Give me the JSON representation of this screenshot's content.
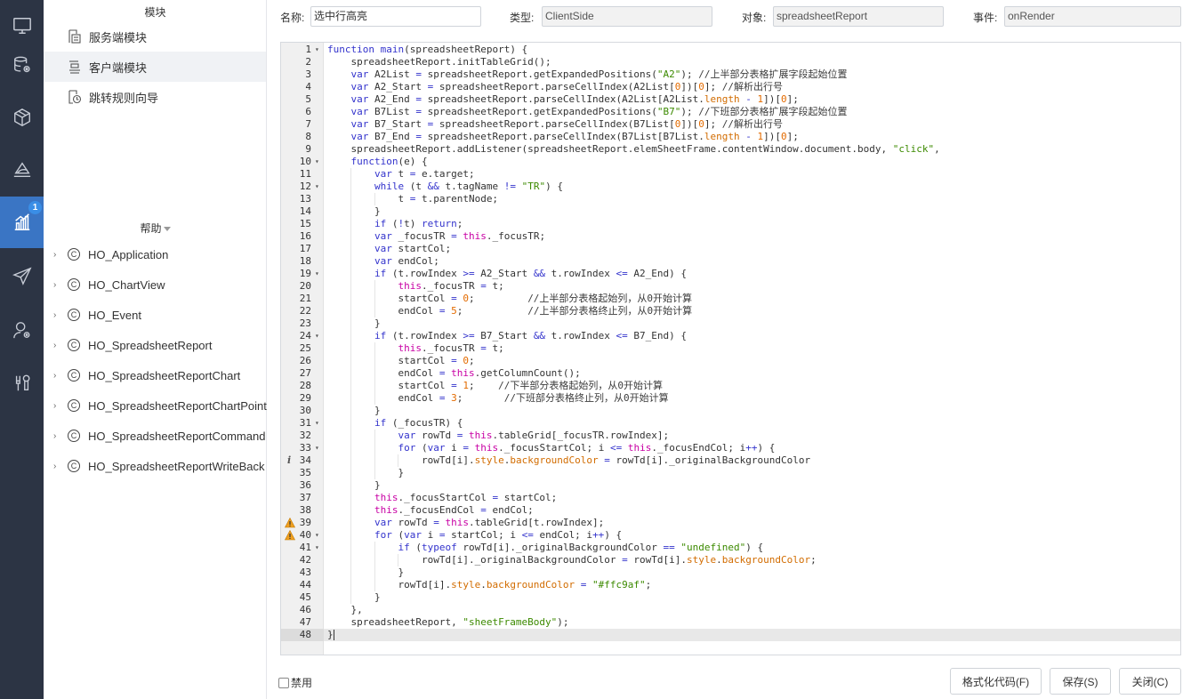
{
  "rail": {
    "items": [
      {
        "icon": "monitor-icon"
      },
      {
        "icon": "database-gear-icon"
      },
      {
        "icon": "cube-icon"
      },
      {
        "icon": "layers-icon"
      },
      {
        "icon": "chart-bar-icon",
        "badge": "1",
        "active": true
      },
      {
        "icon": "send-icon"
      },
      {
        "icon": "user-settings-icon"
      },
      {
        "icon": "tools-icon"
      }
    ]
  },
  "modules": {
    "title": "模块",
    "items": [
      {
        "label": "服务端模块",
        "icon": "server-module-icon"
      },
      {
        "label": "客户端模块",
        "icon": "client-module-icon",
        "selected": true
      },
      {
        "label": "跳转规则向导",
        "icon": "redirect-wizard-icon"
      }
    ]
  },
  "help": {
    "title": "帮助",
    "items": [
      "HO_Application",
      "HO_ChartView",
      "HO_Event",
      "HO_SpreadsheetReport",
      "HO_SpreadsheetReportChart",
      "HO_SpreadsheetReportChartPoint",
      "HO_SpreadsheetReportCommand",
      "HO_SpreadsheetReportWriteBack"
    ]
  },
  "form": {
    "name_label": "名称:",
    "name_value": "选中行高亮",
    "type_label": "类型:",
    "type_value": "ClientSide",
    "object_label": "对象:",
    "object_value": "spreadsheetReport",
    "event_label": "事件:",
    "event_value": "onRender"
  },
  "editor": {
    "current_line": 48,
    "lines": [
      "function main(spreadsheetReport) {",
      "    spreadsheetReport.initTableGrid();",
      "    var A2List = spreadsheetReport.getExpandedPositions(\"A2\"); //上半部分表格扩展字段起始位置",
      "    var A2_Start = spreadsheetReport.parseCellIndex(A2List[0])[0]; //解析出行号",
      "    var A2_End = spreadsheetReport.parseCellIndex(A2List[A2List.length - 1])[0];",
      "    var B7List = spreadsheetReport.getExpandedPositions(\"B7\"); //下班部分表格扩展字段起始位置",
      "    var B7_Start = spreadsheetReport.parseCellIndex(B7List[0])[0]; //解析出行号",
      "    var B7_End = spreadsheetReport.parseCellIndex(B7List[B7List.length - 1])[0];",
      "    spreadsheetReport.addListener(spreadsheetReport.elemSheetFrame.contentWindow.document.body, \"click\",",
      "    function(e) {",
      "        var t = e.target;",
      "        while (t && t.tagName != \"TR\") {",
      "            t = t.parentNode;",
      "        }",
      "        if (!t) return;",
      "        var _focusTR = this._focusTR;",
      "        var startCol;",
      "        var endCol;",
      "        if (t.rowIndex >= A2_Start && t.rowIndex <= A2_End) {",
      "            this._focusTR = t;",
      "            startCol = 0;         //上半部分表格起始列，从0开始计算",
      "            endCol = 5;           //上半部分表格终止列，从0开始计算",
      "        }",
      "        if (t.rowIndex >= B7_Start && t.rowIndex <= B7_End) {",
      "            this._focusTR = t;",
      "            startCol = 0;",
      "            endCol = this.getColumnCount();",
      "            startCol = 1;    //下半部分表格起始列，从0开始计算",
      "            endCol = 3;       //下班部分表格终止列，从0开始计算",
      "        }",
      "        if (_focusTR) {",
      "            var rowTd = this.tableGrid[_focusTR.rowIndex];",
      "            for (var i = this._focusStartCol; i <= this._focusEndCol; i++) {",
      "                rowTd[i].style.backgroundColor = rowTd[i]._originalBackgroundColor",
      "            }",
      "        }",
      "        this._focusStartCol = startCol;",
      "        this._focusEndCol = endCol;",
      "        var rowTd = this.tableGrid[t.rowIndex];",
      "        for (var i = startCol; i <= endCol; i++) {",
      "            if (typeof rowTd[i]._originalBackgroundColor == \"undefined\") {",
      "                rowTd[i]._originalBackgroundColor = rowTd[i].style.backgroundColor;",
      "            }",
      "            rowTd[i].style.backgroundColor = \"#ffc9af\";",
      "        }",
      "    },",
      "    spreadsheetReport, \"sheetFrameBody\");",
      "}"
    ],
    "fold_lines": [
      1,
      10,
      12,
      19,
      24,
      31,
      33,
      40,
      41
    ],
    "warning_lines": [
      39,
      40
    ],
    "info_lines": [
      34
    ]
  },
  "bottom": {
    "disable_label": "禁用",
    "format_button": "格式化代码(F)",
    "save_button": "保存(S)",
    "close_button": "关闭(C)"
  },
  "colors": {
    "rail_bg": "#2c3444",
    "rail_active": "#3a75c4",
    "keyword": "#3333cc",
    "string": "#3c8a00",
    "number": "#e36b00"
  }
}
